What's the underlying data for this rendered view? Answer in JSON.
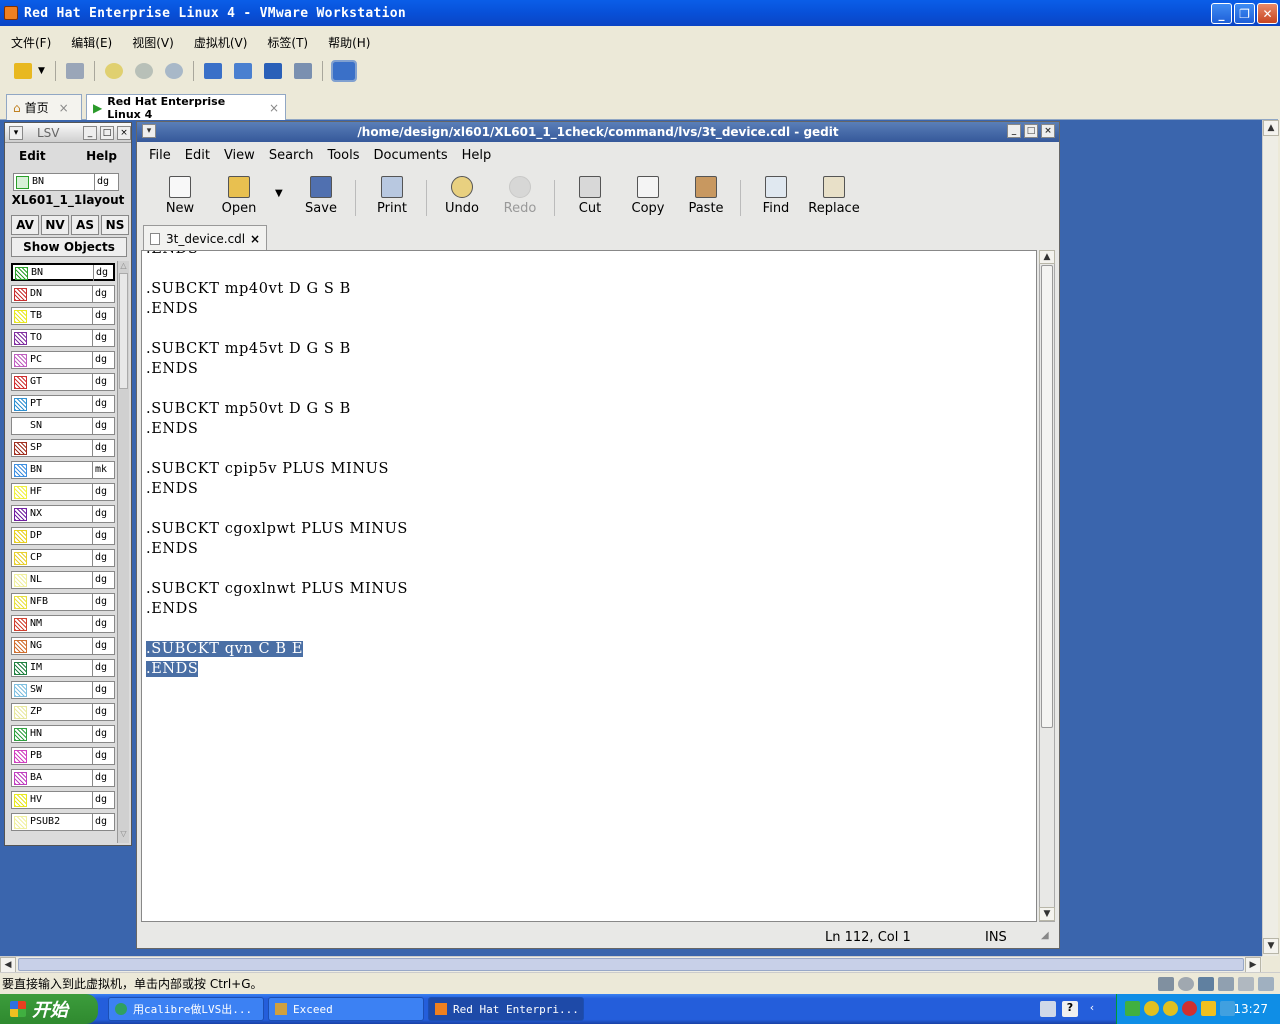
{
  "vmware": {
    "title": "Red Hat Enterprise Linux 4 - VMware Workstation",
    "menu": [
      "文件(F)",
      "编辑(E)",
      "视图(V)",
      "虚拟机(V)",
      "标签(T)",
      "帮助(H)"
    ],
    "tabs": [
      {
        "label": "首页",
        "close": "×"
      },
      {
        "label": "Red Hat Enterprise Linux 4",
        "close": "×"
      }
    ],
    "status": "要直接输入到此虚拟机，单击内部或按 Ctrl+G。"
  },
  "lsv": {
    "title": "LSV",
    "menu": {
      "edit": "Edit",
      "help": "Help"
    },
    "current_layer": {
      "name": "BN",
      "purpose": "dg"
    },
    "cell_name": "XL601_1_1layout",
    "buttons": [
      "AV",
      "NV",
      "AS",
      "NS"
    ],
    "show_objects": "Show Objects",
    "layers": [
      {
        "name": "BN",
        "purpose": "dg",
        "color": "#2aa02a"
      },
      {
        "name": "DN",
        "purpose": "dg",
        "color": "#c83030"
      },
      {
        "name": "TB",
        "purpose": "dg",
        "color": "#e8e820"
      },
      {
        "name": "TO",
        "purpose": "dg",
        "color": "#8030a0"
      },
      {
        "name": "PC",
        "purpose": "dg",
        "color": "#c060c0"
      },
      {
        "name": "GT",
        "purpose": "dg",
        "color": "#d03030"
      },
      {
        "name": "PT",
        "purpose": "dg",
        "color": "#3090d0"
      },
      {
        "name": "SN",
        "purpose": "dg",
        "color": "#ffffff"
      },
      {
        "name": "SP",
        "purpose": "dg",
        "color": "#a03020"
      },
      {
        "name": "BN",
        "purpose": "mk",
        "color": "#4090e0"
      },
      {
        "name": "HF",
        "purpose": "dg",
        "color": "#f0f040"
      },
      {
        "name": "NX",
        "purpose": "dg",
        "color": "#7020a0"
      },
      {
        "name": "DP",
        "purpose": "dg",
        "color": "#e8d020"
      },
      {
        "name": "CP",
        "purpose": "dg",
        "color": "#e8d030"
      },
      {
        "name": "NL",
        "purpose": "dg",
        "color": "#f0f0a0"
      },
      {
        "name": "NFB",
        "purpose": "dg",
        "color": "#e8e040"
      },
      {
        "name": "NM",
        "purpose": "dg",
        "color": "#d04030"
      },
      {
        "name": "NG",
        "purpose": "dg",
        "color": "#d07030"
      },
      {
        "name": "IM",
        "purpose": "dg",
        "color": "#208040"
      },
      {
        "name": "SW",
        "purpose": "dg",
        "color": "#80c0e0"
      },
      {
        "name": "ZP",
        "purpose": "dg",
        "color": "#e8e8a0"
      },
      {
        "name": "HN",
        "purpose": "dg",
        "color": "#30a040"
      },
      {
        "name": "PB",
        "purpose": "dg",
        "color": "#d040c0"
      },
      {
        "name": "BA",
        "purpose": "dg",
        "color": "#c040c0"
      },
      {
        "name": "HV",
        "purpose": "dg",
        "color": "#e8e820"
      },
      {
        "name": "PSUB2",
        "purpose": "dg",
        "color": "#f0f0a0"
      }
    ]
  },
  "gedit": {
    "title": "/home/design/xl601/XL601_1_1check/command/lvs/3t_device.cdl - gedit",
    "menu": [
      "File",
      "Edit",
      "View",
      "Search",
      "Tools",
      "Documents",
      "Help"
    ],
    "toolbar": {
      "new": "New",
      "open": "Open",
      "save": "Save",
      "print": "Print",
      "undo": "Undo",
      "redo": "Redo",
      "cut": "Cut",
      "copy": "Copy",
      "paste": "Paste",
      "find": "Find",
      "replace": "Replace"
    },
    "tab": {
      "label": "3t_device.cdl",
      "close": "×"
    },
    "lines": [
      ".ENDS",
      "",
      ".SUBCKT mp40vt D G S B",
      ".ENDS",
      "",
      ".SUBCKT mp45vt D G S B",
      ".ENDS",
      "",
      ".SUBCKT mp50vt D G S B",
      ".ENDS",
      "",
      ".SUBCKT cpip5v PLUS MINUS",
      ".ENDS",
      "",
      ".SUBCKT cgoxlpwt PLUS MINUS",
      ".ENDS",
      "",
      ".SUBCKT cgoxlnwt PLUS MINUS",
      ".ENDS",
      ""
    ],
    "selected_lines": [
      ".SUBCKT qvn C B E",
      ".ENDS"
    ],
    "status": {
      "position": "Ln 112, Col 1",
      "mode": "INS"
    }
  },
  "taskbar": {
    "start": "开始",
    "tasks": [
      "用calibre做LVS出...",
      "Exceed",
      "Red Hat Enterpri..."
    ],
    "clock": "13:27"
  },
  "colors": {
    "xp_blue": "#245edb",
    "selection": "#4a6fa5",
    "desktop": "#3a65ad"
  }
}
